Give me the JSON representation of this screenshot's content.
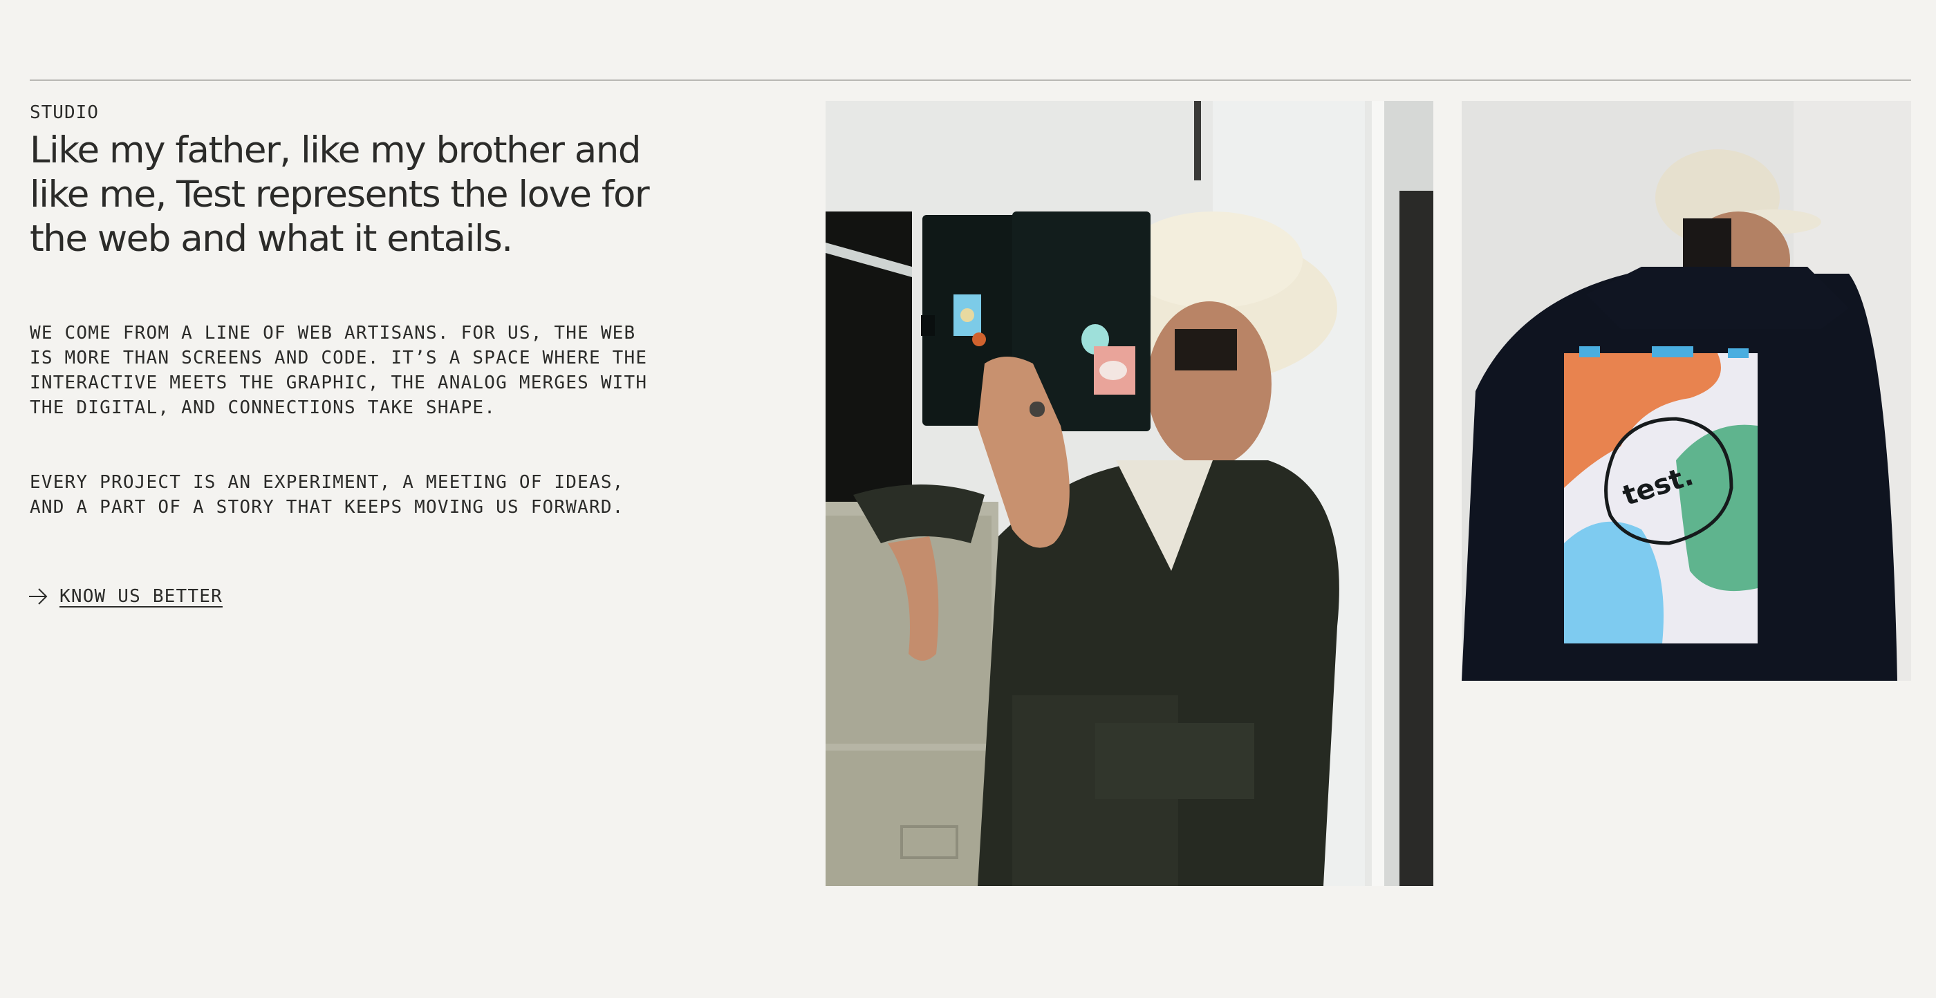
{
  "studio": {
    "label": "STUDIO",
    "headline": "Like my father, like my brother and like me, Test represents the love for the web and what it entails.",
    "paragraph_1": "WE COME FROM A LINE OF WEB ARTISANS. FOR US, THE WEB IS MORE THAN SCREENS AND CODE. IT’S A SPACE WHERE THE INTERACTIVE MEETS THE GRAPHIC, THE ANALOG MERGES WITH THE DIGITAL, AND CONNECTIONS TAKE SHAPE.",
    "paragraph_2": "EVERY PROJECT IS AN EXPERIMENT, A MEETING OF IDEAS, AND A PART OF A STORY THAT KEEPS MOVING US FORWARD.",
    "cta_label": "KNOW US BETTER",
    "cta_icon": "arrow-right-icon"
  },
  "photos": {
    "photo_1_poster_text": "",
    "photo_2_poster_text": "test."
  },
  "colors": {
    "background": "#f4f3f0",
    "text": "#2b2b29",
    "poster_orange": "#e8834f",
    "poster_green": "#5fb48e",
    "poster_blue": "#7ecbf0"
  }
}
